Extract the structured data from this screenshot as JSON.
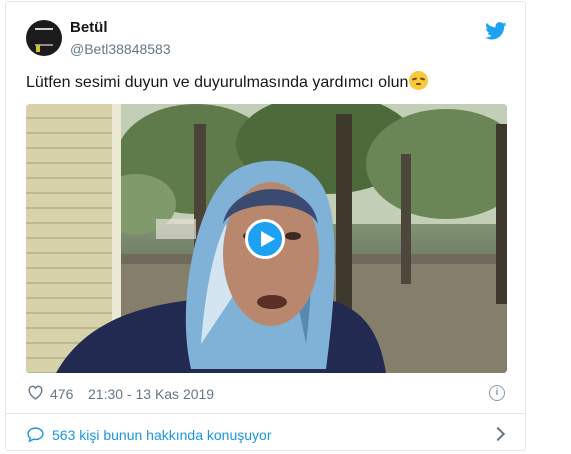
{
  "author": {
    "name": "Betül",
    "handle": "@Betl38848583"
  },
  "tweet": {
    "text": "Lütfen sesimi duyun ve duyurulmasında yardımcı olun"
  },
  "stats": {
    "likes": "476",
    "timestamp": "21:30 - 13 Kas 2019"
  },
  "footer": {
    "talking": "563 kişi bunun hakkında konuşuyor"
  },
  "icons": [
    "twitter-bird-icon",
    "play-icon",
    "heart-icon",
    "info-icon",
    "speech-bubble-icon",
    "chevron-right-icon",
    "pensive-face-emoji"
  ],
  "colors": {
    "brand": "#1da1f2",
    "link": "#1b95e0",
    "muted": "#657786",
    "border": "#e1e8ed"
  }
}
